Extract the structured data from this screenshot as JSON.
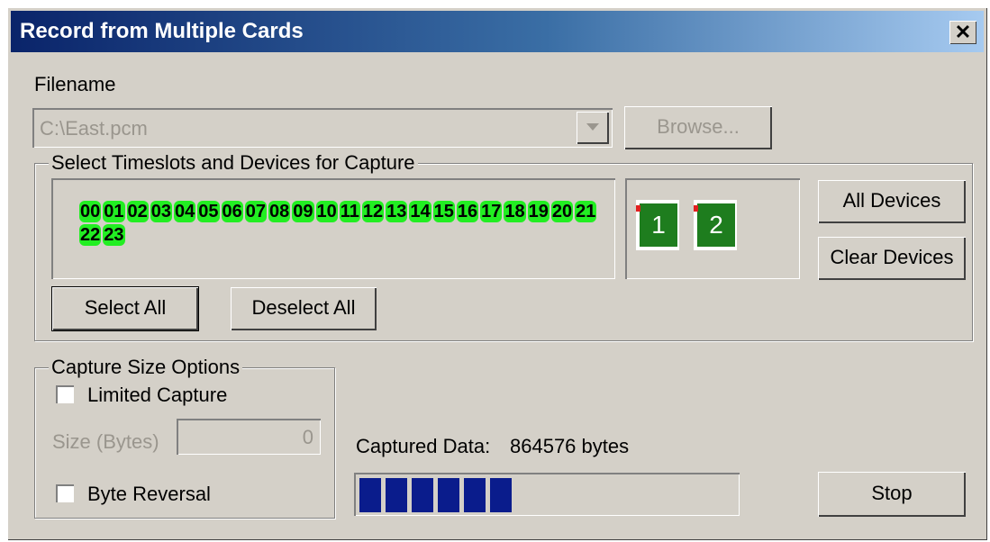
{
  "dialog": {
    "title": "Record from Multiple Cards",
    "close_label": "✕"
  },
  "filename": {
    "label": "Filename",
    "value": "C:\\East.pcm",
    "browse_label": "Browse..."
  },
  "timeslots_group": {
    "title": "Select Timeslots and Devices for Capture",
    "slots": [
      "00",
      "01",
      "02",
      "03",
      "04",
      "05",
      "06",
      "07",
      "08",
      "09",
      "10",
      "11",
      "12",
      "13",
      "14",
      "15",
      "16",
      "17",
      "18",
      "19",
      "20",
      "21",
      "22",
      "23"
    ],
    "select_all_label": "Select All",
    "deselect_all_label": "Deselect All"
  },
  "devices": {
    "cards": [
      "1",
      "2"
    ],
    "all_devices_label": "All Devices",
    "clear_devices_label": "Clear Devices"
  },
  "capture_size": {
    "title": "Capture Size Options",
    "limited_capture_label": "Limited Capture",
    "limited_capture_checked": false,
    "size_label": "Size (Bytes)",
    "size_value": "0",
    "byte_reversal_label": "Byte Reversal",
    "byte_reversal_checked": false
  },
  "capture_status": {
    "label": "Captured Data:",
    "value": "864576 bytes",
    "progress_blocks_filled": 6
  },
  "stop_label": "Stop",
  "colors": {
    "slot_green": "#22ee22",
    "card_green": "#1e7d1e",
    "progress_blue": "#0a1c8c",
    "title_blue": "#0a246a"
  }
}
